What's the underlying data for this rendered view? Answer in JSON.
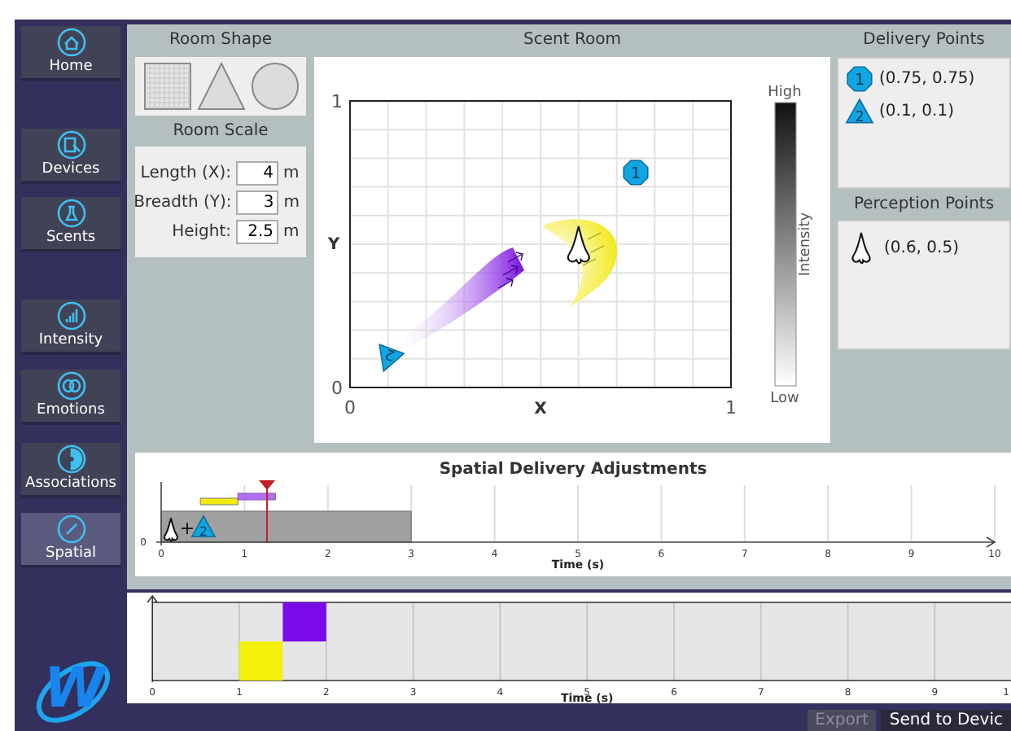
{
  "sidebar": {
    "items": [
      {
        "label": "Home",
        "selected": false
      },
      {
        "label": "Devices",
        "selected": false
      },
      {
        "label": "Scents",
        "selected": false
      },
      {
        "label": "Intensity",
        "selected": false
      },
      {
        "label": "Emotions",
        "selected": false
      },
      {
        "label": "Associations",
        "selected": false
      },
      {
        "label": "Spatial",
        "selected": true
      }
    ]
  },
  "room_shape": {
    "title": "Room Shape",
    "options": [
      {
        "kind": "square"
      },
      {
        "kind": "triangle"
      },
      {
        "kind": "circle"
      }
    ]
  },
  "room_scale": {
    "title": "Room Scale",
    "fields": [
      {
        "label": "Length (X):",
        "value": "4",
        "unit": "m"
      },
      {
        "label": "Breadth (Y):",
        "value": "3",
        "unit": "m"
      },
      {
        "label": "Height:",
        "value": "2.5",
        "unit": "m"
      }
    ]
  },
  "scent_room": {
    "title": "Scent Room",
    "y_ticks": [
      "1",
      "0"
    ],
    "x_ticks": [
      "0",
      "1"
    ],
    "xlabel": "X",
    "ylabel": "Y",
    "markers": [
      {
        "kind": "octagon",
        "label": "1"
      },
      {
        "kind": "triangle",
        "label": "2"
      },
      {
        "kind": "nose"
      }
    ],
    "colorbar": {
      "high": "High",
      "low": "Low",
      "label": "Intensity"
    }
  },
  "delivery_points": {
    "title": "Delivery Points",
    "items": [
      {
        "kind": "octagon",
        "badge": "1",
        "coords": "(0.75, 0.75)"
      },
      {
        "kind": "triangle",
        "badge": "2",
        "coords": "(0.1, 0.1)"
      }
    ]
  },
  "perception_points": {
    "title": "Perception Points",
    "items": [
      {
        "kind": "nose",
        "coords": "(0.6, 0.5)"
      }
    ]
  },
  "adjustments": {
    "title": "Spatial Delivery Adjustments",
    "y_tick": "0",
    "x_ticks": [
      "0",
      "1",
      "2",
      "3",
      "4",
      "5",
      "6",
      "7",
      "8",
      "9",
      "10"
    ],
    "xlabel": "Time (s)",
    "plus": "+",
    "badge": "2"
  },
  "sequence": {
    "x_ticks": [
      "0",
      "1",
      "2",
      "3",
      "4",
      "5",
      "6",
      "7",
      "8",
      "9",
      "1"
    ],
    "xlabel": "Time (s)"
  },
  "logo": {
    "text": "W"
  },
  "buttons": [
    {
      "label": "Export",
      "disabled": true
    },
    {
      "label": "Send to Devic",
      "disabled": false
    }
  ]
}
